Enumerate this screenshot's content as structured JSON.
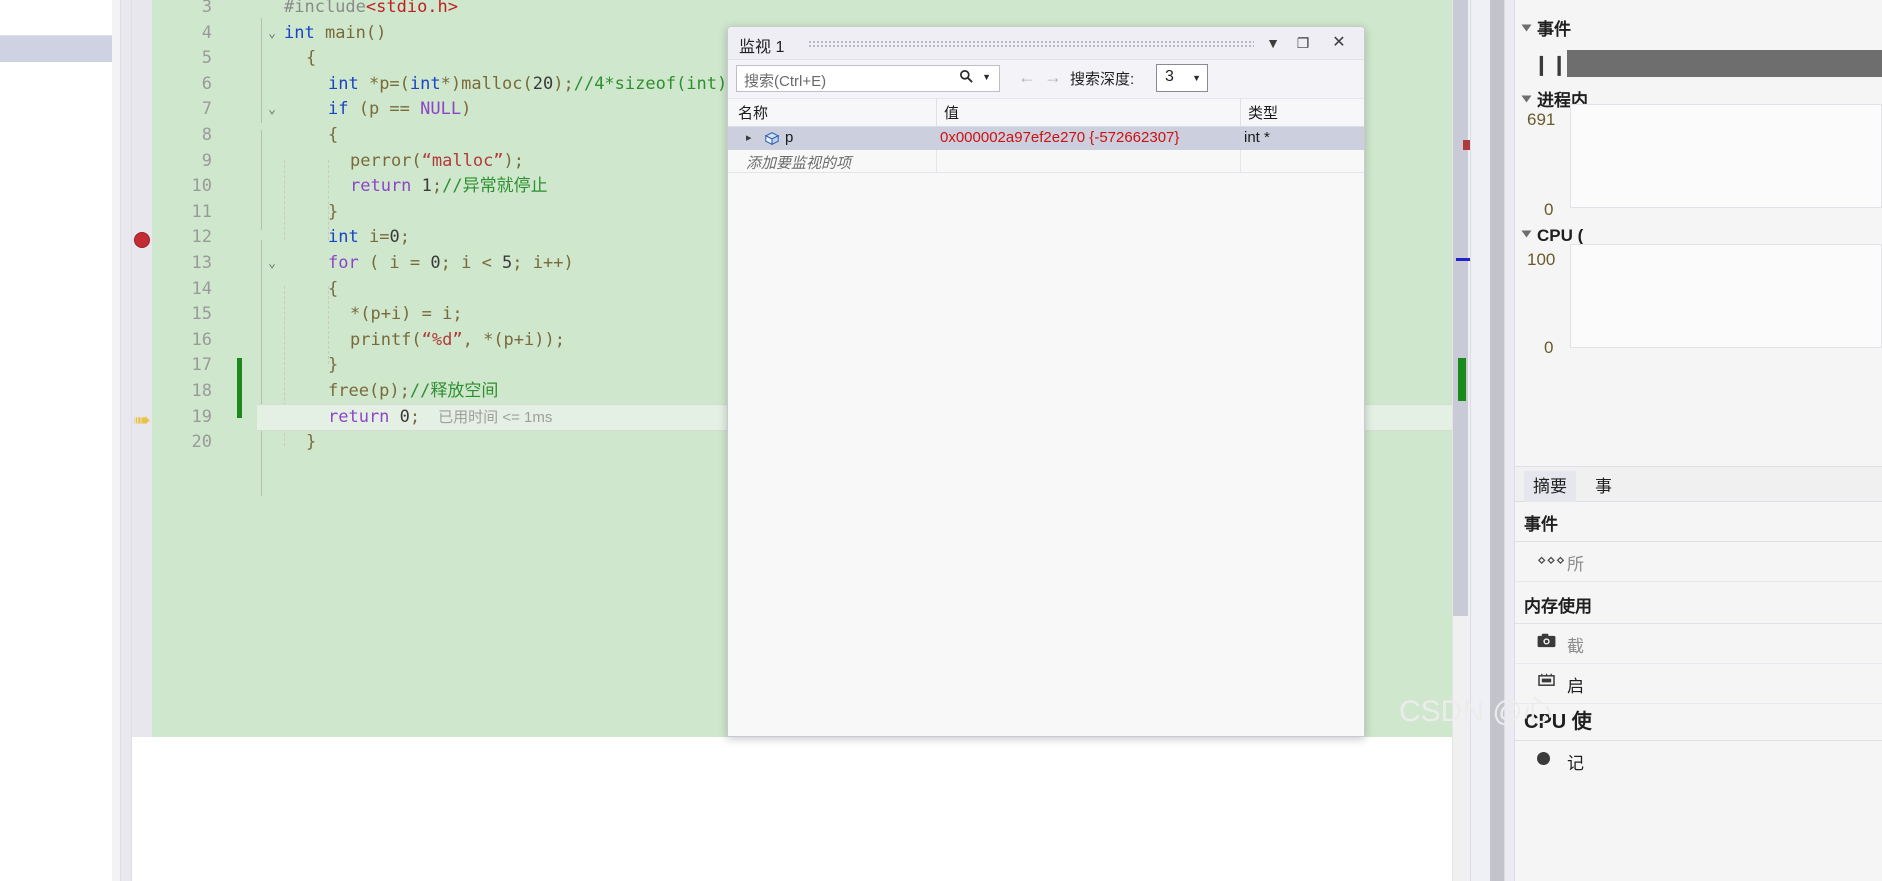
{
  "editor": {
    "lines": [
      {
        "num": "3",
        "fold": "",
        "segments": [
          {
            "t": "#include",
            "c": "k-gray"
          },
          {
            "t": "<stdio.h>",
            "c": "k-red"
          }
        ]
      },
      {
        "num": "4",
        "fold": "⌄",
        "segments": [
          {
            "t": "int",
            "c": "k-blue"
          },
          {
            "t": " main()",
            "c": "k-plain"
          }
        ]
      },
      {
        "num": "5",
        "fold": "",
        "segments": [
          {
            "t": "{",
            "c": "k-plain"
          }
        ],
        "indent": 1
      },
      {
        "num": "6",
        "fold": "",
        "segments": [
          {
            "t": "int",
            "c": "k-blue"
          },
          {
            "t": " *p=(",
            "c": "k-plain"
          },
          {
            "t": "int",
            "c": "k-blue"
          },
          {
            "t": "*)malloc(",
            "c": "k-plain"
          },
          {
            "t": "20",
            "c": "k-black"
          },
          {
            "t": ");",
            "c": "k-plain"
          },
          {
            "t": "//4*sizeof(int)",
            "c": "k-comment"
          }
        ],
        "indent": 2
      },
      {
        "num": "7",
        "fold": "⌄",
        "segments": [
          {
            "t": "if",
            "c": "k-blue"
          },
          {
            "t": " (p == ",
            "c": "k-plain"
          },
          {
            "t": "NULL",
            "c": "k-purple"
          },
          {
            "t": ")",
            "c": "k-plain"
          }
        ],
        "indent": 2
      },
      {
        "num": "8",
        "fold": "",
        "segments": [
          {
            "t": "{",
            "c": "k-plain"
          }
        ],
        "indent": 2
      },
      {
        "num": "9",
        "fold": "",
        "segments": [
          {
            "t": "perror(",
            "c": "k-plain"
          },
          {
            "t": "“malloc”",
            "c": "k-str"
          },
          {
            "t": ");",
            "c": "k-plain"
          }
        ],
        "indent": 3
      },
      {
        "num": "10",
        "fold": "",
        "segments": [
          {
            "t": "return",
            "c": "k-purple"
          },
          {
            "t": " ",
            "c": "k-plain"
          },
          {
            "t": "1",
            "c": "k-black"
          },
          {
            "t": ";",
            "c": "k-plain"
          },
          {
            "t": "//异常就停止",
            "c": "k-comment"
          }
        ],
        "indent": 3
      },
      {
        "num": "11",
        "fold": "",
        "segments": [
          {
            "t": "}",
            "c": "k-plain"
          }
        ],
        "indent": 2
      },
      {
        "num": "12",
        "fold": "",
        "segments": [
          {
            "t": "int",
            "c": "k-blue"
          },
          {
            "t": " i=",
            "c": "k-plain"
          },
          {
            "t": "0",
            "c": "k-black"
          },
          {
            "t": ";",
            "c": "k-plain"
          }
        ],
        "indent": 2
      },
      {
        "num": "13",
        "fold": "⌄",
        "segments": [
          {
            "t": "for",
            "c": "k-purple"
          },
          {
            "t": " ( i = ",
            "c": "k-plain"
          },
          {
            "t": "0",
            "c": "k-black"
          },
          {
            "t": "; i < ",
            "c": "k-plain"
          },
          {
            "t": "5",
            "c": "k-black"
          },
          {
            "t": "; i++)",
            "c": "k-plain"
          }
        ],
        "indent": 2
      },
      {
        "num": "14",
        "fold": "",
        "segments": [
          {
            "t": "{",
            "c": "k-plain"
          }
        ],
        "indent": 2
      },
      {
        "num": "15",
        "fold": "",
        "segments": [
          {
            "t": "*(p+i) = i;",
            "c": "k-plain"
          }
        ],
        "indent": 3
      },
      {
        "num": "16",
        "fold": "",
        "segments": [
          {
            "t": "printf(",
            "c": "k-plain"
          },
          {
            "t": "“%d”",
            "c": "k-str"
          },
          {
            "t": ", *(p+i));",
            "c": "k-plain"
          }
        ],
        "indent": 3
      },
      {
        "num": "17",
        "fold": "",
        "segments": [
          {
            "t": "}",
            "c": "k-plain"
          }
        ],
        "indent": 2
      },
      {
        "num": "18",
        "fold": "",
        "segments": [
          {
            "t": "free(p);",
            "c": "k-plain"
          },
          {
            "t": "//释放空间",
            "c": "k-comment"
          }
        ],
        "indent": 2
      },
      {
        "num": "19",
        "fold": "",
        "segments": [
          {
            "t": "return",
            "c": "k-purple"
          },
          {
            "t": " ",
            "c": "k-plain"
          },
          {
            "t": "0",
            "c": "k-black"
          },
          {
            "t": ";",
            "c": "k-plain"
          }
        ],
        "indent": 2
      },
      {
        "num": "20",
        "fold": "",
        "segments": [
          {
            "t": "}",
            "c": "k-plain"
          }
        ],
        "indent": 1
      }
    ],
    "elapsed_time": "已用时间 <= 1ms",
    "current_line": "19",
    "breakpoint_line": "12"
  },
  "watch": {
    "title": "监视 1",
    "dropdown_icon": "▼",
    "maximize_icon": "❐",
    "close_icon": "✕",
    "search_placeholder": "搜索(Ctrl+E)",
    "search_icon": "🔍",
    "caret_icon": "▼",
    "nav_back_icon": "←",
    "nav_forward_icon": "→",
    "depth_label": "搜索深度:",
    "depth_value": "3",
    "columns": [
      "名称",
      "值",
      "类型"
    ],
    "rows": [
      {
        "expander": "▸",
        "name": "p",
        "value": "0x000002a97ef2e270 {-572662307}",
        "type": "int *"
      }
    ],
    "add_row_placeholder": "添加要监视的项"
  },
  "diagnostics": {
    "events_header": "事件",
    "pause_icon": "❙❙",
    "process_memory_header": "进程内",
    "memory_max": "691",
    "memory_min": "0",
    "cpu_header": "CPU (",
    "cpu_max": "100",
    "cpu_min": "0",
    "tabs": [
      {
        "label": "摘要",
        "active": true
      },
      {
        "label": "事",
        "active": false
      }
    ],
    "sections": [
      {
        "header": "事件",
        "rows": [
          {
            "icon": "⋄⋄⋄",
            "text": "所"
          }
        ]
      },
      {
        "header": "内存使用",
        "rows": [
          {
            "icon": "📷",
            "text": "截"
          },
          {
            "icon": "▒",
            "text": "启"
          }
        ]
      },
      {
        "header": "CPU 使",
        "rows": [
          {
            "icon": "●",
            "text": "记"
          }
        ]
      }
    ]
  },
  "watermark": "CSDN @心"
}
